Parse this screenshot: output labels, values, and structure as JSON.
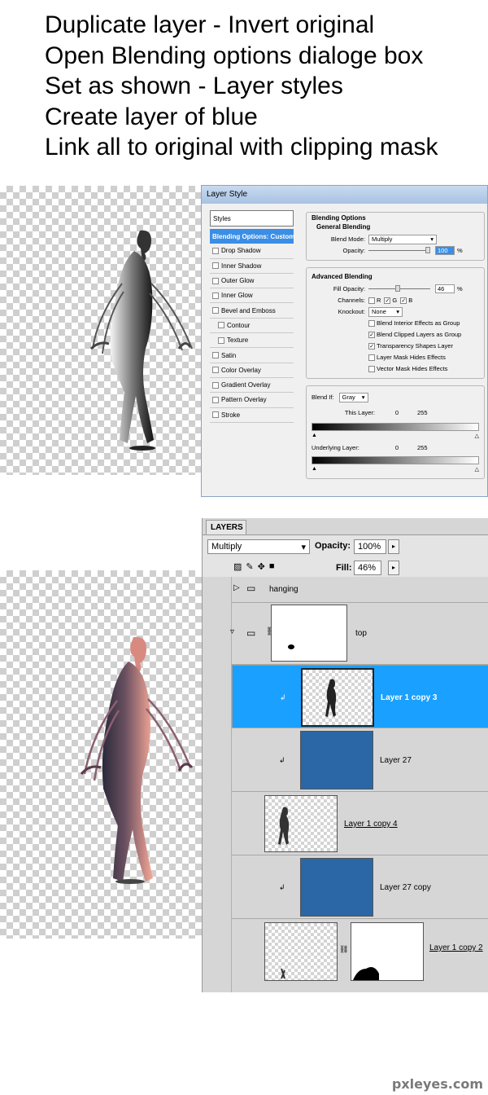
{
  "instructions": [
    "Duplicate layer - Invert original",
    "Open Blending options dialoge box",
    "Set as shown - Layer styles",
    "Create layer of blue",
    "Link all to original with clipping mask"
  ],
  "layer_style": {
    "title": "Layer Style",
    "styles_header": "Styles",
    "styles": [
      {
        "label": "Blending Options: Custom",
        "selected": true
      },
      {
        "label": "Drop Shadow"
      },
      {
        "label": "Inner Shadow"
      },
      {
        "label": "Outer Glow"
      },
      {
        "label": "Inner Glow"
      },
      {
        "label": "Bevel and Emboss"
      },
      {
        "label": "Contour",
        "sub": true
      },
      {
        "label": "Texture",
        "sub": true
      },
      {
        "label": "Satin"
      },
      {
        "label": "Color Overlay"
      },
      {
        "label": "Gradient Overlay"
      },
      {
        "label": "Pattern Overlay"
      },
      {
        "label": "Stroke"
      }
    ],
    "blending_options_title": "Blending Options",
    "general_blending_title": "General Blending",
    "blend_mode_label": "Blend Mode:",
    "blend_mode_value": "Multiply",
    "opacity_label": "Opacity:",
    "opacity_value": "100",
    "percent": "%",
    "advanced_blending_title": "Advanced Blending",
    "fill_opacity_label": "Fill Opacity:",
    "fill_opacity_value": "46",
    "channels_label": "Channels:",
    "channel_r": "R",
    "channel_g": "G",
    "channel_b": "B",
    "knockout_label": "Knockout:",
    "knockout_value": "None",
    "checkboxes": [
      {
        "label": "Blend Interior Effects as Group",
        "checked": false
      },
      {
        "label": "Blend Clipped Layers as Group",
        "checked": true
      },
      {
        "label": "Transparency Shapes Layer",
        "checked": true
      },
      {
        "label": "Layer Mask Hides Effects",
        "checked": false
      },
      {
        "label": "Vector Mask Hides Effects",
        "checked": false
      }
    ],
    "blend_if_label": "Blend If:",
    "blend_if_value": "Gray",
    "this_layer_label": "This Layer:",
    "this_layer_low": "0",
    "this_layer_high": "255",
    "underlying_label": "Underlying Layer:",
    "underlying_low": "0",
    "underlying_high": "255"
  },
  "layers_panel": {
    "tab": "LAYERS",
    "blend_mode": "Multiply",
    "opacity_label": "Opacity:",
    "opacity_value": "100%",
    "lock_label": "Lock:",
    "fill_label": "Fill:",
    "fill_value": "46%",
    "layers": [
      {
        "name": "hanging",
        "kind": "group-collapsed"
      },
      {
        "name": "top",
        "kind": "group-expanded"
      },
      {
        "name": "Layer 1 copy 3",
        "kind": "clipped-figure",
        "selected": true
      },
      {
        "name": "Layer 27",
        "kind": "clipped-blue"
      },
      {
        "name": "Layer 1 copy 4",
        "kind": "base-figure"
      },
      {
        "name": "Layer 27 copy",
        "kind": "clipped-blue"
      },
      {
        "name": "Layer 1 copy 2",
        "kind": "masked"
      }
    ]
  },
  "colors": {
    "layer_blue": "#2b66a6",
    "selected_row": "#1aa0ff",
    "figure_tint": "#f09a8c"
  },
  "watermark": "pxleyes.com"
}
